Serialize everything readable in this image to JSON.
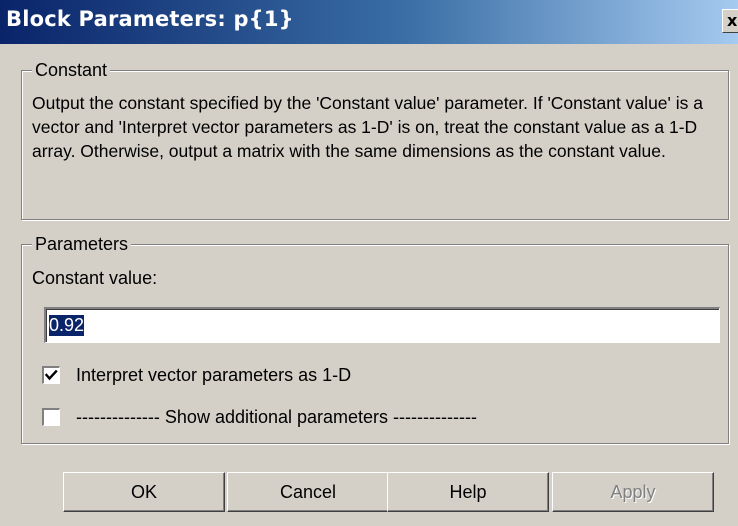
{
  "window": {
    "title": "Block Parameters: p{1}",
    "close_glyph": "x"
  },
  "constant_group": {
    "legend": "Constant",
    "description": "Output the constant specified by the 'Constant value' parameter. If 'Constant value' is a vector and 'Interpret vector parameters as 1-D' is on, treat the constant value as a 1-D array. Otherwise, output a matrix with the same dimensions as the constant value."
  },
  "parameters_group": {
    "legend": "Parameters",
    "constant_value_label": "Constant value:",
    "constant_value": "0.92",
    "interpret_vector": {
      "label": "Interpret vector parameters as 1-D",
      "checked": true
    },
    "show_additional": {
      "label": "-------------- Show additional parameters --------------",
      "checked": false
    }
  },
  "buttons": {
    "ok": "OK",
    "cancel": "Cancel",
    "help": "Help",
    "apply": "Apply",
    "apply_enabled": false
  },
  "colors": {
    "face": "#d4d0c8",
    "title_start": "#0a246a",
    "title_end": "#a6caf0",
    "selection": "#0a246a",
    "disabled_text": "#808080"
  }
}
